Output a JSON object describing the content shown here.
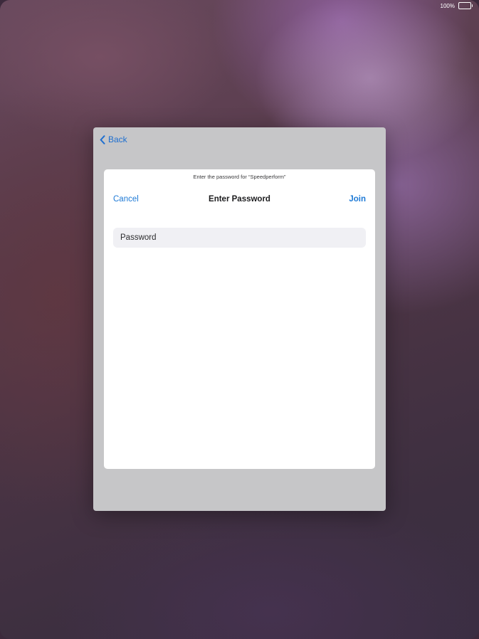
{
  "status_bar": {
    "battery_percent": "100%",
    "battery_icon": "battery-full-icon"
  },
  "sheet": {
    "back_label": "Back",
    "back_icon": "chevron-left-icon"
  },
  "dialog": {
    "prompt": "Enter the password for “Speedperform”",
    "title": "Enter Password",
    "cancel_label": "Cancel",
    "join_label": "Join",
    "password_placeholder": "Password",
    "password_value": ""
  },
  "colors": {
    "accent": "#1e7ad6",
    "sheet_background": "#c6c6c8",
    "field_background": "#f0f0f4"
  }
}
